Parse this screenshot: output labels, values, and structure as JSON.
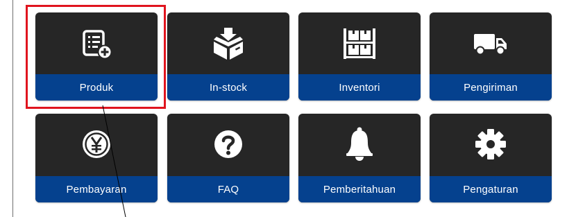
{
  "menu": {
    "tiles": [
      {
        "label": "Produk",
        "icon": "product-add-icon"
      },
      {
        "label": "In-stock",
        "icon": "box-in-icon"
      },
      {
        "label": "Inventori",
        "icon": "shelf-icon"
      },
      {
        "label": "Pengiriman",
        "icon": "truck-icon"
      },
      {
        "label": "Pembayaran",
        "icon": "yen-coin-icon"
      },
      {
        "label": "FAQ",
        "icon": "question-icon"
      },
      {
        "label": "Pemberitahuan",
        "icon": "bell-icon"
      },
      {
        "label": "Pengaturan",
        "icon": "gear-icon"
      }
    ]
  },
  "colors": {
    "tile_bg": "#262626",
    "label_bar": "#05418e",
    "highlight": "#e0141e"
  }
}
